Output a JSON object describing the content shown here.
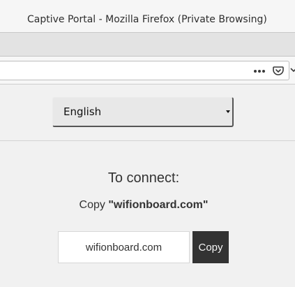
{
  "window": {
    "title": "Captive Portal - Mozilla Firefox (Private Browsing)"
  },
  "toolbar": {
    "icons": [
      "page-actions-icon",
      "pocket-icon",
      "overflow-chevron-icon"
    ]
  },
  "portal": {
    "language_selected": "English",
    "connect_title": "To connect:",
    "copy_prefix": "Copy",
    "copy_target": "\"wifionboard.com\"",
    "domain_value": "wifionboard.com",
    "copy_button_label": "Copy"
  },
  "colors": {
    "copy_button_bg": "#333333",
    "page_bg": "#f1f1f1"
  }
}
